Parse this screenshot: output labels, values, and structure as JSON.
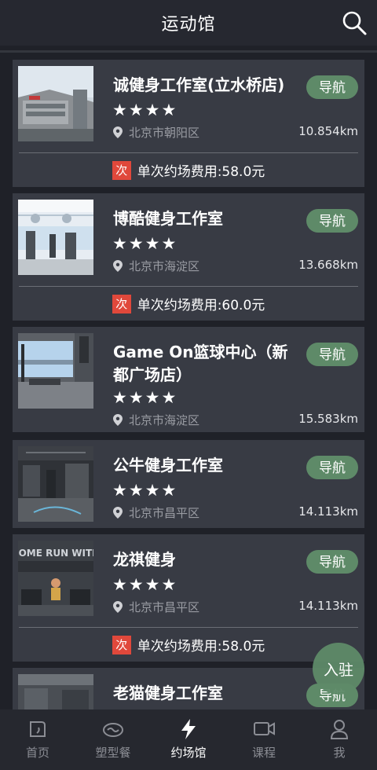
{
  "header": {
    "title": "运动馆"
  },
  "gyms": [
    {
      "name": "诚健身工作室(立水桥店)",
      "stars": "★★★★",
      "nav_label": "导航",
      "location": "北京市朝阳区",
      "distance": "10.854km",
      "fee_badge": "次",
      "fee": "单次约场费用:58.0元"
    },
    {
      "name": "博酷健身工作室",
      "stars": "★★★★",
      "nav_label": "导航",
      "location": "北京市海淀区",
      "distance": "13.668km",
      "fee_badge": "次",
      "fee": "单次约场费用:60.0元"
    },
    {
      "name": "Game On篮球中心（新都广场店）",
      "stars": "★★★★",
      "nav_label": "导航",
      "location": "北京市海淀区",
      "distance": "15.583km"
    },
    {
      "name": "公牛健身工作室",
      "stars": "★★★★",
      "nav_label": "导航",
      "location": "北京市昌平区",
      "distance": "14.113km"
    },
    {
      "name": "龙祺健身",
      "stars": "★★★★",
      "nav_label": "导航",
      "location": "北京市昌平区",
      "distance": "14.113km",
      "fee_badge": "次",
      "fee": "单次约场费用:58.0元",
      "image_text": "COME RUN WITH"
    },
    {
      "name": "老猫健身工作室",
      "nav_label": "导航"
    }
  ],
  "fab": {
    "label": "入驻"
  },
  "tabbar": [
    {
      "label": "首页",
      "icon": "home-icon"
    },
    {
      "label": "塑型餐",
      "icon": "meal-icon"
    },
    {
      "label": "约场馆",
      "icon": "lightning-icon",
      "active": true
    },
    {
      "label": "课程",
      "icon": "video-icon"
    },
    {
      "label": "我",
      "icon": "person-icon"
    }
  ]
}
